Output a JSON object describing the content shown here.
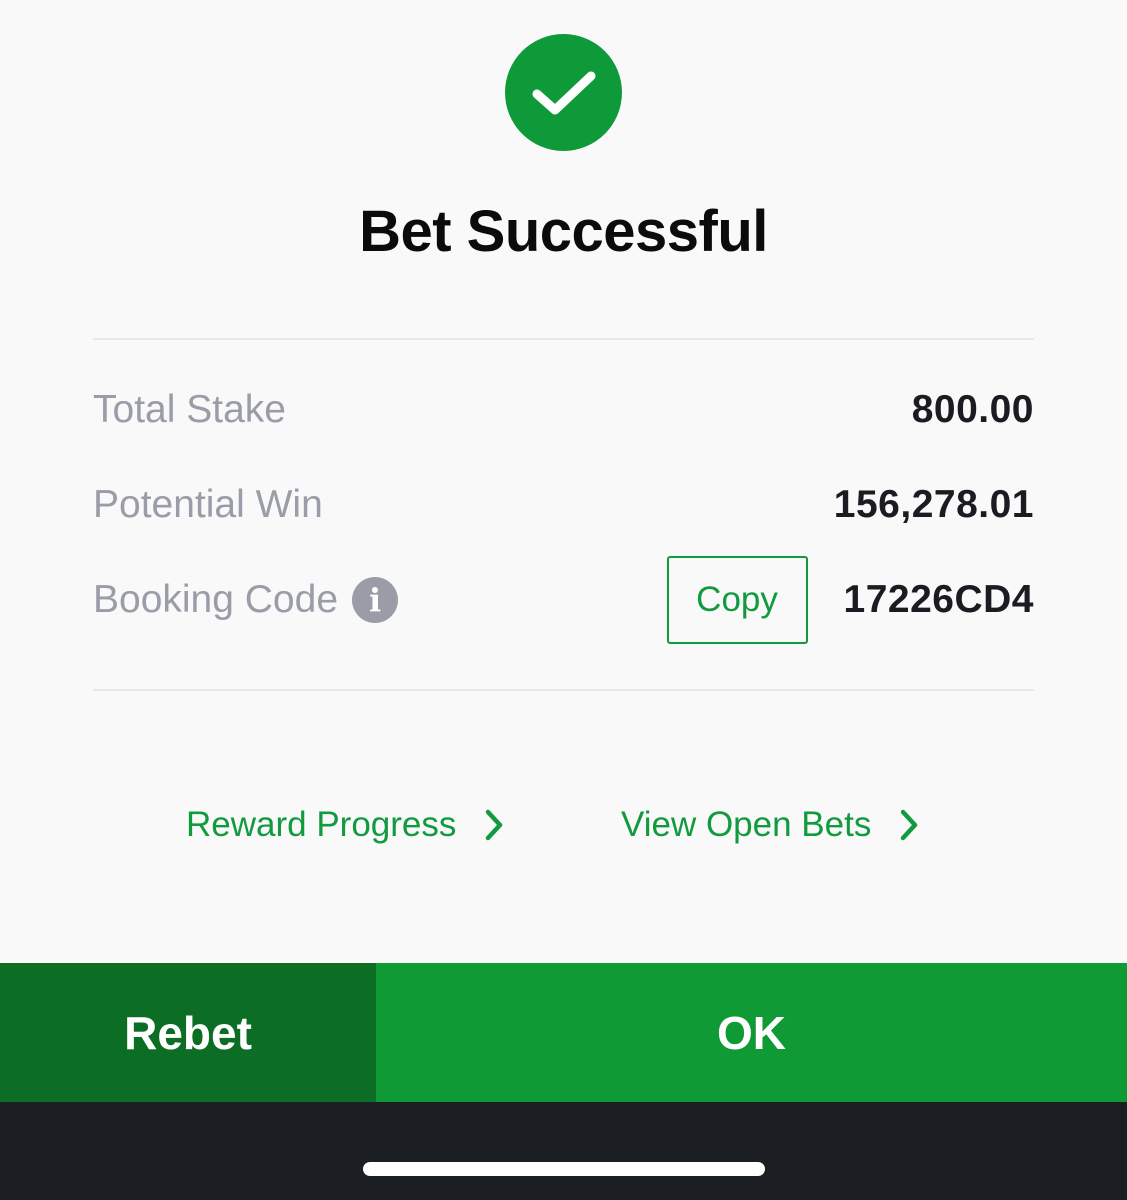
{
  "header": {
    "icon": "checkmark-circle-icon",
    "title": "Bet Successful"
  },
  "summary": {
    "total_stake_label": "Total Stake",
    "total_stake_value": "800.00",
    "potential_win_label": "Potential Win",
    "potential_win_value": "156,278.01",
    "booking_code_label": "Booking Code",
    "booking_code_info_icon": "info-icon",
    "copy_label": "Copy",
    "booking_code_value": "17226CD4"
  },
  "links": {
    "reward_progress": "Reward Progress",
    "view_open_bets": "View Open Bets"
  },
  "actions": {
    "rebet_label": "Rebet",
    "ok_label": "OK"
  },
  "colors": {
    "brand_green": "#0f9a36",
    "dark_green": "#0b6e24",
    "label_gray": "#9a9ca8",
    "home_bar": "#1b1e22"
  }
}
